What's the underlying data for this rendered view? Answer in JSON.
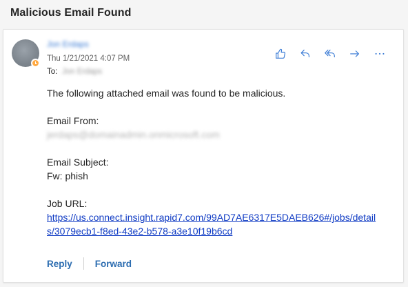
{
  "subject": "Malicious Email Found",
  "sender": {
    "name": "Jon Erdaps",
    "date": "Thu 1/21/2021 4:07 PM",
    "to_label": "To:",
    "to_value": "Jon Erdaps",
    "presence": "away-icon"
  },
  "actions": {
    "like": "thumbs-up-icon",
    "reply": "reply-icon",
    "reply_all": "reply-all-icon",
    "forward": "forward-icon",
    "more": "more-icon"
  },
  "body": {
    "intro": "The following attached email was found to be malicious.",
    "from_label": "Email From:",
    "from_value": "jerdaps@domainadmin.onmicrosoft.com",
    "subject_label": "Email Subject:",
    "subject_value": "Fw: phish",
    "job_label": "Job URL:",
    "job_url": "https://us.connect.insight.rapid7.com/99AD7AE6317E5DAEB626#/jobs/details/3079ecb1-f8ed-43e2-b578-a3e10f19b6cd"
  },
  "footer": {
    "reply": "Reply",
    "forward": "Forward"
  },
  "colors": {
    "accent": "#2b6cb0",
    "icon": "#3a7bd5",
    "link": "#0f3bc4",
    "presence_away": "#ffaa44"
  }
}
